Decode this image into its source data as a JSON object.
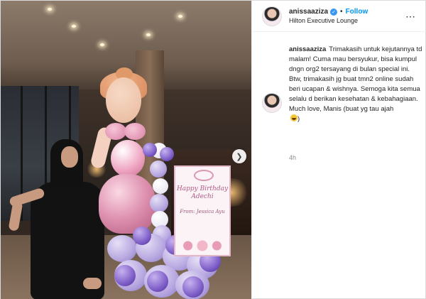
{
  "header": {
    "username": "anissaaziza",
    "follow_label": "Follow",
    "separator": "•",
    "location": "Hilton Executive Lounge"
  },
  "caption": {
    "username": "anissaaziza",
    "text": "Trimakasih untuk kejutannya td malam! Cuma mau bersyukur, bisa kumpul dngn org2 tersayang di bulan special ini. Btw, trimakasih jg buat tmn2 online sudah beri ucapan & wishnya. Semoga kita semua selalu d berikan kesehatan & kebahagiaan.",
    "signoff": "Much love, Manis (buat yg tau ajah",
    "time": "4h"
  },
  "photo": {
    "card_line1": "Happy Birthday",
    "card_line2": "Adechi",
    "card_from": "From: Jessica Ayu"
  },
  "icons": {
    "verified": "verified-badge-icon",
    "more": "more-options-icon",
    "next": "chevron-right-icon",
    "emoji": "grinning-sweat-emoji"
  },
  "colors": {
    "follow": "#0095f6",
    "verified": "#3897f0",
    "muted": "#8e8e8e"
  }
}
